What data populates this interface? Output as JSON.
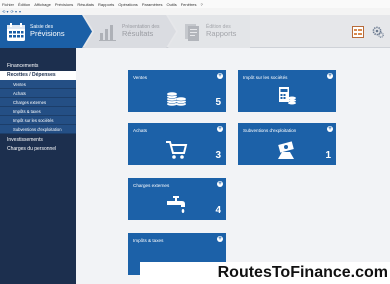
{
  "menu": [
    "Fichier",
    "Édition",
    "Affichage",
    "Prévisions",
    "Résultats",
    "Rapports",
    "Opérations",
    "Paramètres",
    "Outils",
    "Fenêtres",
    "?"
  ],
  "qat": [
    "⟲ ▾",
    "⟳ ▾",
    "▾"
  ],
  "steps": [
    {
      "l1": "Saisie des",
      "l2": "Prévisions"
    },
    {
      "l1": "Présentation des",
      "l2": "Résultats"
    },
    {
      "l1": "Édition des",
      "l2": "Rapports"
    }
  ],
  "sidebar": {
    "financements": "Financements",
    "active": "Recettes / Dépenses",
    "subs": [
      "Ventes",
      "Achats",
      "Charges externes",
      "Impôts & taxes",
      "Impôt sur les sociétés",
      "Subventions d'exploitation"
    ],
    "investissements": "Investissements",
    "personnel": "Charges du personnel"
  },
  "tiles": [
    {
      "title": "Ventes",
      "count": "5",
      "icon": "coins-icon"
    },
    {
      "title": "Impôt sur les sociétés",
      "count": "",
      "icon": "calculator-icon"
    },
    {
      "title": "Achats",
      "count": "3",
      "icon": "cart-icon"
    },
    {
      "title": "Subventions d'exploitation",
      "count": "1",
      "icon": "money-icon"
    },
    {
      "title": "Charges externes",
      "count": "4",
      "icon": "tap-icon"
    },
    {
      "title": "Impôts & taxes",
      "count": "",
      "icon": "tax-icon"
    }
  ],
  "watermark": "RoutesToFinance.com",
  "colors": {
    "brand": "#1b5fa6",
    "sidebar": "#1c2f4e",
    "tile": "#1c61a8"
  }
}
